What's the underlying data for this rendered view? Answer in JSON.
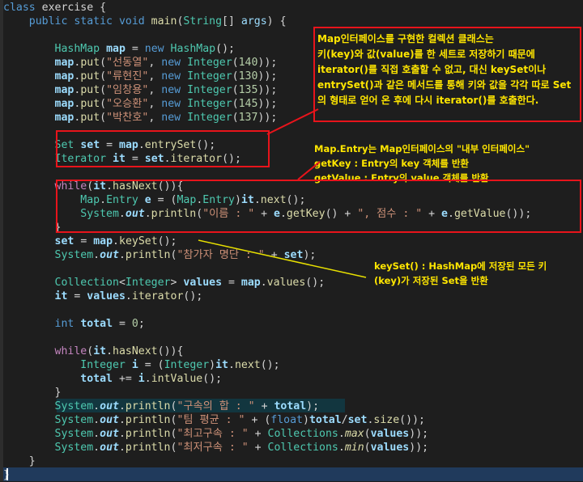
{
  "code": {
    "lines": [
      [
        "class exercise {"
      ],
      [
        "    public static void main(String[] args) {"
      ],
      [
        ""
      ],
      [
        "        HashMap map = new HashMap();"
      ],
      [
        "        map.put(\"선동열\", new Integer(140));"
      ],
      [
        "        map.put(\"류현진\", new Integer(130));"
      ],
      [
        "        map.put(\"임창용\", new Integer(135));"
      ],
      [
        "        map.put(\"오승환\", new Integer(145));"
      ],
      [
        "        map.put(\"박찬호\", new Integer(137));"
      ],
      [
        ""
      ],
      [
        "        Set set = map.entrySet();"
      ],
      [
        "        Iterator it = set.iterator();"
      ],
      [
        ""
      ],
      [
        "        while(it.hasNext()){"
      ],
      [
        "            Map.Entry e = (Map.Entry)it.next();"
      ],
      [
        "            System.out.println(\"이름 : \" + e.getKey() + \", 점수 : \" + e.getValue());"
      ],
      [
        "        }"
      ],
      [
        "        set = map.keySet();"
      ],
      [
        "        System.out.println(\"참가자 명단 : \" + set);"
      ],
      [
        ""
      ],
      [
        "        Collection<Integer> values = map.values();"
      ],
      [
        "        it = values.iterator();"
      ],
      [
        ""
      ],
      [
        "        int total = 0;"
      ],
      [
        ""
      ],
      [
        "        while(it.hasNext()){"
      ],
      [
        "            Integer i = (Integer)it.next();"
      ],
      [
        "            total += i.intValue();"
      ],
      [
        "        }"
      ],
      [
        "        System.out.println(\"구속의 합 : \" + total);"
      ],
      [
        "        System.out.println(\"팀 평균 : \" + (float)total/set.size());"
      ],
      [
        "        System.out.println(\"최고구속 : \" + Collections.max(values));"
      ],
      [
        "        System.out.println(\"최저구속 : \" + Collections.min(values));"
      ],
      [
        "    }"
      ],
      [
        "}"
      ]
    ]
  },
  "annotations": {
    "note1": "Map인터페이스를 구현한 컬렉션 클래스는\n키(key)와 값(value)를 한 세트로 저장하기 때문에\niterator()를 직접 호출할 수 없고, 대신 keySet이나\nentrySet()과 같은 메서드를 통해 키와 값을 각각 따로 Set\n의 형태로 얻어 온 후에 다시 iterator()를 호출한다.",
    "note2": "Map.Entry는 Map인터페이스의 \"내부 인터페이스\"\ngetKey : Entry의 key 객체를 반환\ngetValue : Entry의 value 객체를 반환",
    "note3": "keySet() : HashMap에 저장된 모든 키\n(key)가 저장된 Set을 반환"
  },
  "colors": {
    "background": "#1e1e1e",
    "annotation_box": "#e8141b",
    "annotation_text": "#ffe600",
    "keyword": "#569cd6",
    "type": "#4ec9b0",
    "string": "#ce9178",
    "number": "#b5cea8",
    "method": "#dcdcaa",
    "variable": "#9cdcfe"
  }
}
